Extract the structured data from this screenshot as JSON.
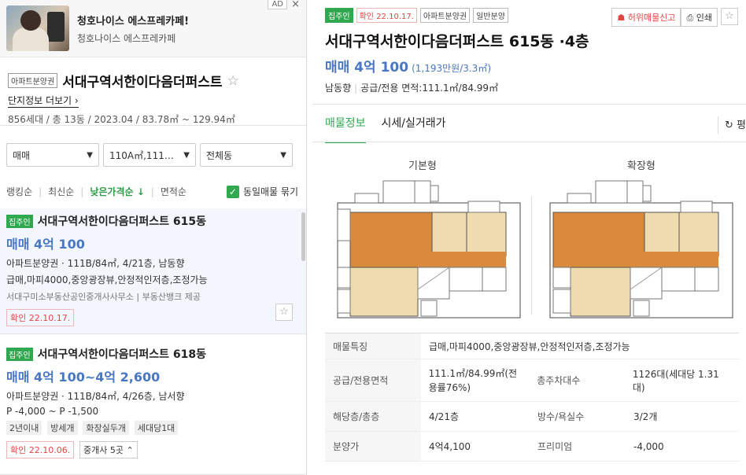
{
  "ad": {
    "badge": "AD",
    "close": "×",
    "title": "청호나이스 에스프레카페!",
    "subtitle": "청호나이스 에스프레카페"
  },
  "complex": {
    "type_tag": "아파트분양권",
    "name": "서대구역서한이다음더퍼스트",
    "more": "단지정보 더보기",
    "summary": "856세대 / 총 13동 / 2023.04 / 83.78㎡ ~ 129.94㎡"
  },
  "filters": {
    "trade": "매매",
    "area": "110A㎡,111…",
    "dong": "전체동"
  },
  "sort": {
    "options": [
      "랭킹순",
      "최신순",
      "낮은가격순 ↓",
      "면적순"
    ],
    "same_group": "동일매물 묶기"
  },
  "listings": [
    {
      "badge": "집주인",
      "title": "서대구역서한이다음더퍼스트 615동",
      "price": "매매 4억 100",
      "spec": "아파트분양권 · 111B/84㎡, 4/21층, 남동향",
      "features": "급매,마피4000,중앙광장뷰,안정적인저층,조정가능",
      "agent": "서대구미소부동산공인중개사사무소 | 부동산뱅크 제공",
      "confirm": "확인 22.10.17."
    },
    {
      "badge": "집주인",
      "title": "서대구역서한이다음더퍼스트 618동",
      "price": "매매 4억 100~4억 2,600",
      "spec": "아파트분양권 · 111B/84㎡, 4/26층, 남서향",
      "premium": "P -4,000 ~ P -1,500",
      "chips": [
        "2년이내",
        "방세개",
        "화장실두개",
        "세대당1대"
      ],
      "confirm": "확인 22.10.06.",
      "agents": "중개사 5곳 ⌃"
    }
  ],
  "detail": {
    "tags": [
      "집주인",
      "확인 22.10.17.",
      "아파트분양권",
      "일반분양"
    ],
    "report": "허위매물신고",
    "print": "인쇄",
    "title": "서대구역서한이다음더퍼스트 615동 ·4층",
    "price": "매매 4억 100",
    "price_unit": "(1,193만원/3.3㎡)",
    "direction": "남동향",
    "area": "공급/전용 면적:111.1㎡/84.99㎡",
    "tabs": [
      "매물정보",
      "시세/실거래가"
    ],
    "refresh": "평",
    "plan_labels": [
      "기본형",
      "확장형"
    ],
    "rows": [
      {
        "l1": "매물특징",
        "v1": "급매,마피4000,중앙광장뷰,안정적인저층,조정가능"
      },
      {
        "l1": "공급/전용면적",
        "v1": "111.1㎡/84.99㎡(전용률76%)",
        "l2": "총주차대수",
        "v2": "1126대(세대당 1.31대)"
      },
      {
        "l1": "해당층/총층",
        "v1": "4/21층",
        "l2": "방수/욕실수",
        "v2": "3/2개"
      },
      {
        "l1": "분양가",
        "v1": "4억4,100",
        "l2": "프리미엄",
        "v2": "-4,000"
      }
    ]
  },
  "colors": {
    "green": "#2fa84f",
    "price_blue": "#4a77c4",
    "red": "#e04646"
  }
}
